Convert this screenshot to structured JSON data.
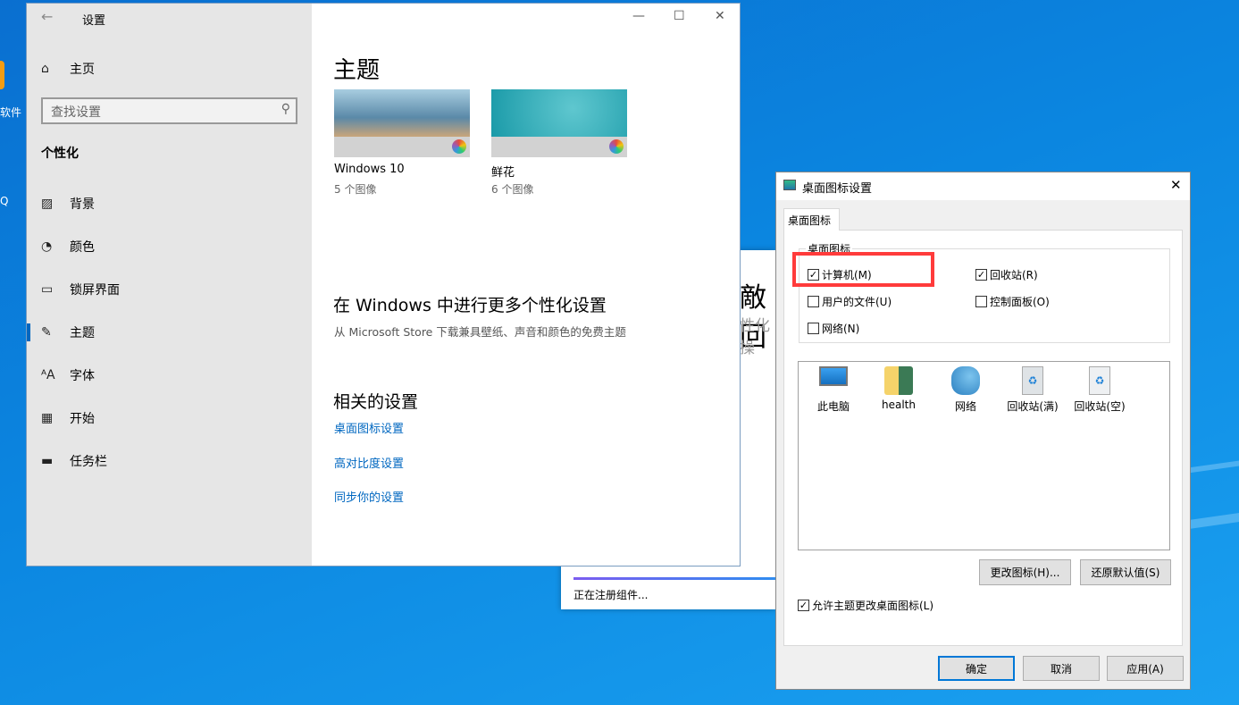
{
  "desktop": {
    "icons": [
      {
        "label": "软件"
      },
      {
        "label": "Q"
      }
    ]
  },
  "settings": {
    "title": "设置",
    "home": "主页",
    "search_placeholder": "查找设置",
    "section": "个性化",
    "nav": [
      {
        "label": "背景",
        "icon": "image-icon"
      },
      {
        "label": "颜色",
        "icon": "palette-icon"
      },
      {
        "label": "锁屏界面",
        "icon": "lock-screen-icon"
      },
      {
        "label": "主题",
        "icon": "theme-icon",
        "selected": true
      },
      {
        "label": "字体",
        "icon": "font-icon"
      },
      {
        "label": "开始",
        "icon": "start-icon"
      },
      {
        "label": "任务栏",
        "icon": "taskbar-icon"
      }
    ],
    "page_title": "主题",
    "themes": [
      {
        "name": "Windows 10",
        "count": "5 个图像"
      },
      {
        "name": "鲜花",
        "count": "6 个图像"
      }
    ],
    "more_title": "在 Windows 中进行更多个性化设置",
    "more_sub": "从 Microsoft Store 下载兼具壁纸、声音和颜色的免费主题",
    "related_title": "相关的设置",
    "related_links": [
      "桌面图标设置",
      "高对比度设置",
      "同步你的设置"
    ],
    "accent": "#0067c0"
  },
  "installer": {
    "heading": "敵回",
    "sub": "性化操",
    "status": "正在注册组件..."
  },
  "dialog": {
    "title": "桌面图标设置",
    "tab": "桌面图标",
    "group": "桌面图标",
    "checks": [
      {
        "label": "计算机(M)",
        "checked": true
      },
      {
        "label": "回收站(R)",
        "checked": true
      },
      {
        "label": "用户的文件(U)",
        "checked": false
      },
      {
        "label": "控制面板(O)",
        "checked": false
      },
      {
        "label": "网络(N)",
        "checked": false
      }
    ],
    "icons": [
      {
        "label": "此电脑",
        "icon": "computer-icon"
      },
      {
        "label": "health",
        "icon": "user-folder-icon"
      },
      {
        "label": "网络",
        "icon": "network-icon"
      },
      {
        "label": "回收站(满)",
        "icon": "recycle-bin-full-icon"
      },
      {
        "label": "回收站(空)",
        "icon": "recycle-bin-empty-icon"
      }
    ],
    "change_icon": "更改图标(H)...",
    "restore": "还原默认值(S)",
    "allow_theme": "允许主题更改桌面图标(L)",
    "allow_theme_checked": true,
    "ok": "确定",
    "cancel": "取消",
    "apply": "应用(A)",
    "highlight_color": "#ff3b3b"
  }
}
